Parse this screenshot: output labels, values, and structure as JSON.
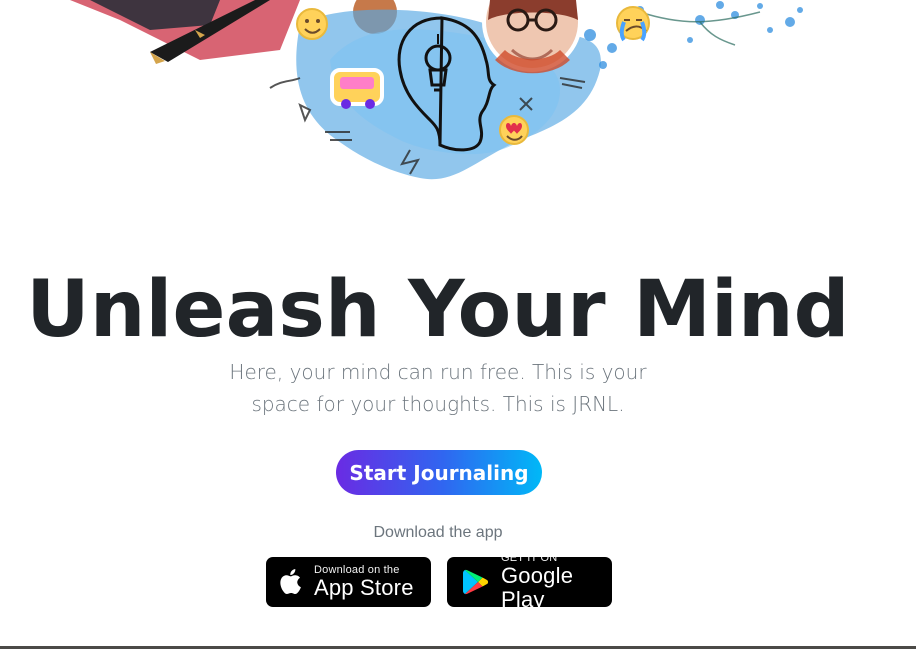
{
  "hero": {
    "title": "Unleash Your Mind",
    "subtitle": "Here, your mind can run free. This is your space for your thoughts. This is JRNL.",
    "cta_label": "Start Journaling",
    "download_label": "Download the app"
  },
  "stores": {
    "app_store": {
      "small": "Download on the",
      "big": "App Store"
    },
    "google_play": {
      "small": "GET IT ON",
      "big": "Google Play"
    }
  },
  "colors": {
    "title": "#212529",
    "subtitle": "#6c757d",
    "cta_gradient_start": "#6a2be3",
    "cta_gradient_mid": "#3066f0",
    "cta_gradient_end": "#00b8f7",
    "badge_bg": "#000000"
  },
  "icons": {
    "apple": "apple-logo-icon",
    "play": "google-play-logo-icon",
    "hero_art": "lightbulb-head-collage-icon"
  }
}
